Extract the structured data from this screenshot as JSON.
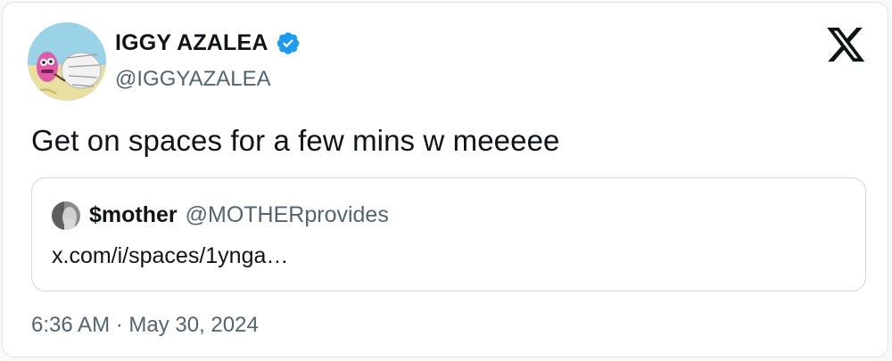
{
  "tweet": {
    "author": {
      "display_name": "IGGY AZALEA",
      "handle": "@IGGYAZALEA",
      "verified": true,
      "avatar_icon": "cartoon-avatar"
    },
    "text": "Get on spaces for a few mins w meeeee",
    "timestamp": "6:36 AM · May 30, 2024"
  },
  "quote": {
    "display_name": "$mother",
    "handle": "@MOTHERprovides",
    "link": "x.com/i/spaces/1ynga…",
    "avatar_icon": "photo-avatar"
  },
  "brand": {
    "logo_icon": "x-logo-icon"
  },
  "colors": {
    "verified_blue": "#1d9bf0",
    "text_primary": "#0f1419",
    "text_secondary": "#536471",
    "border": "#cfd9de"
  }
}
